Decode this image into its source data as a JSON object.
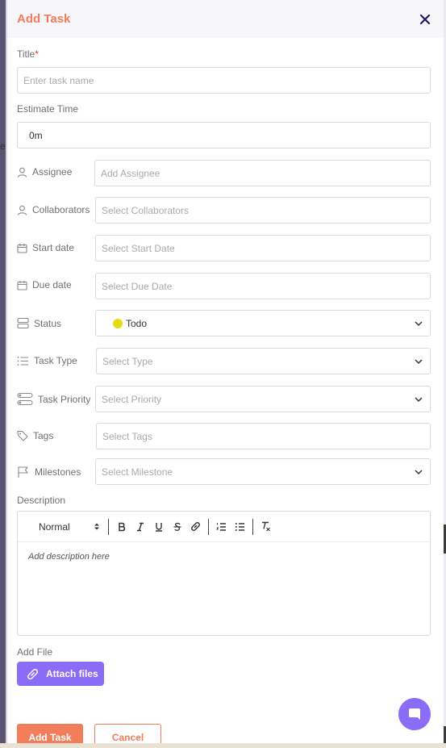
{
  "modal": {
    "title": "Add Task"
  },
  "form": {
    "title_label": "Title",
    "title_required_mark": "*",
    "title_placeholder": "Enter task name",
    "estimate_label": "Estimate Time",
    "estimate_value": "0m",
    "assignee": {
      "label": "Assignee",
      "placeholder": "Add Assignee"
    },
    "collaborators": {
      "label": "Collaborators",
      "placeholder": "Select Collaborators"
    },
    "start_date": {
      "label": "Start date",
      "placeholder": "Select Start Date"
    },
    "due_date": {
      "label": "Due date",
      "placeholder": "Select Due Date"
    },
    "status": {
      "label": "Status",
      "value": "Todo",
      "dot_color": "#e5dc16"
    },
    "task_type": {
      "label": "Task Type",
      "placeholder": "Select Type"
    },
    "task_priority": {
      "label": "Task Priority",
      "placeholder": "Select Priority"
    },
    "tags": {
      "label": "Tags",
      "placeholder": "Select Tags"
    },
    "milestones": {
      "label": "Milestones",
      "placeholder": "Select Milestone"
    },
    "description_label": "Description",
    "editor": {
      "heading_value": "Normal",
      "placeholder": "Add description here",
      "tools": [
        "bold-icon",
        "italic-icon",
        "underline-icon",
        "strike-icon",
        "link-icon",
        "ordered-list-icon",
        "bullet-list-icon",
        "clear-format-icon"
      ]
    },
    "add_file_label": "Add File",
    "attach_label": "Attach files"
  },
  "actions": {
    "submit_label": "Add Task",
    "cancel_label": "Cancel"
  },
  "colors": {
    "accent": "#f27d5b",
    "primary": "#8b6cf6",
    "close": "#1f1a5e"
  },
  "background": {
    "fragment": "e"
  }
}
